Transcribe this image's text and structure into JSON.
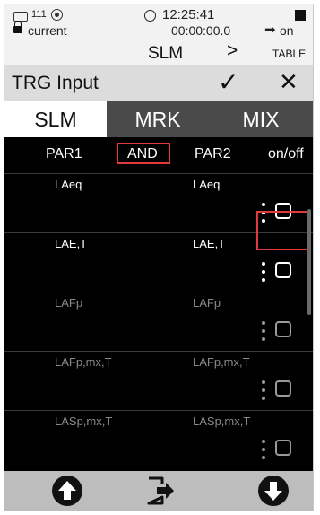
{
  "status": {
    "battery_icon": "battery-icon",
    "counter": "111",
    "time": "12:25:41",
    "measurement": "current",
    "elapsed": "00:00:00.0",
    "arrow": "➡",
    "on_label": "on"
  },
  "mode": {
    "label": "SLM",
    "next_glyph": ">",
    "table_label": "TABLE"
  },
  "title_bar": {
    "title": "TRG Input",
    "confirm_glyph": "✓",
    "close_glyph": "✕"
  },
  "tabs": [
    {
      "label": "SLM",
      "active": true
    },
    {
      "label": "MRK",
      "active": false
    },
    {
      "label": "MIX",
      "active": false
    }
  ],
  "list_header": {
    "par1": "PAR1",
    "operator": "AND",
    "par2": "PAR2",
    "onoff": "on/off"
  },
  "rows": [
    {
      "par1": "LAeq",
      "par2": "LAeq",
      "checked": false,
      "dimmed": false
    },
    {
      "par1": "LAE,T",
      "par2": "LAE,T",
      "checked": false,
      "dimmed": false
    },
    {
      "par1": "LAFp",
      "par2": "LAFp",
      "checked": false,
      "dimmed": true
    },
    {
      "par1": "LAFp,mx,T",
      "par2": "LAFp,mx,T",
      "checked": false,
      "dimmed": true
    },
    {
      "par1": "LASp,mx,T",
      "par2": "LASp,mx,T",
      "checked": false,
      "dimmed": true
    }
  ],
  "colors": {
    "highlight": "#e23a3a",
    "list_bg": "#000000",
    "tab_bg": "#4a4a4a",
    "bottom_bar": "#bdbdbd"
  }
}
